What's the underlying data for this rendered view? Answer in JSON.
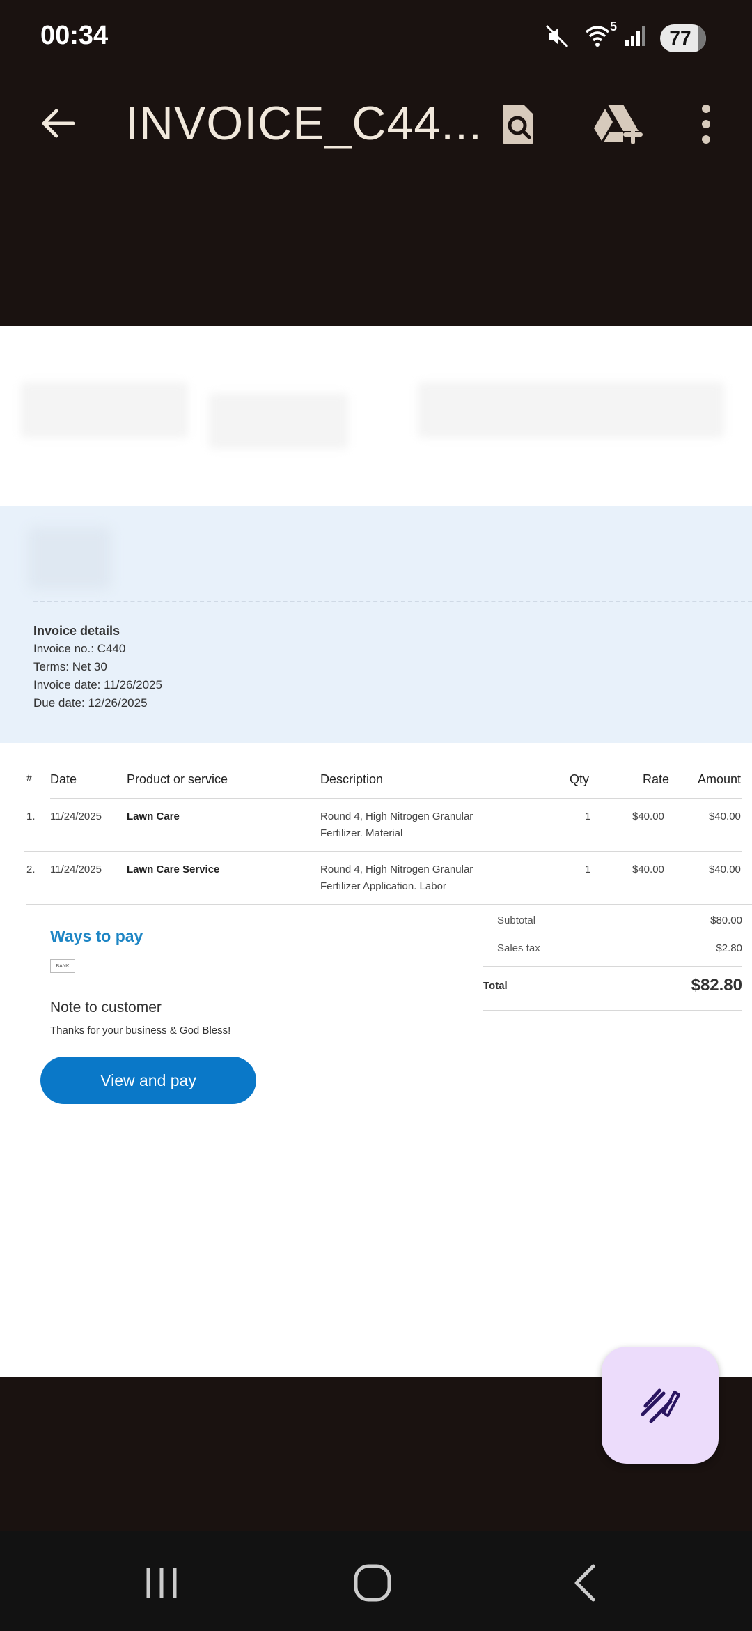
{
  "status": {
    "time": "00:34",
    "wifi_level": "5",
    "battery": "77"
  },
  "app_bar": {
    "title": "INVOICE_C44..."
  },
  "invoice_details": {
    "heading": "Invoice details",
    "invoice_no": "Invoice no.: C440",
    "terms": "Terms: Net 30",
    "invoice_date": "Invoice date: 11/26/2025",
    "due_date": "Due date: 12/26/2025"
  },
  "table": {
    "headers": {
      "num": "#",
      "date": "Date",
      "product": "Product or service",
      "description": "Description",
      "qty": "Qty",
      "rate": "Rate",
      "amount": "Amount"
    },
    "rows": [
      {
        "num": "1.",
        "date": "11/24/2025",
        "product": "Lawn Care",
        "desc1": "Round 4, High Nitrogen Granular",
        "desc2": "Fertilizer. Material",
        "qty": "1",
        "rate": "$40.00",
        "amount": "$40.00"
      },
      {
        "num": "2.",
        "date": "11/24/2025",
        "product": "Lawn Care Service",
        "desc1": "Round 4, High Nitrogen Granular",
        "desc2": "Fertilizer Application. Labor",
        "qty": "1",
        "rate": "$40.00",
        "amount": "$40.00"
      }
    ]
  },
  "payment": {
    "ways_title": "Ways to pay",
    "bank_badge": "BANK",
    "note_title": "Note to customer",
    "note_text": "Thanks for your business & God Bless!",
    "button_label": "View and pay"
  },
  "totals": {
    "subtotal_label": "Subtotal",
    "subtotal": "$80.00",
    "tax_label": "Sales tax",
    "tax": "$2.80",
    "total_label": "Total",
    "total": "$82.80"
  },
  "colors": {
    "accent": "#0a78c8",
    "ways_title": "#1d85c4",
    "band": "#e8f1fa",
    "fab": "#ecdcfb"
  }
}
